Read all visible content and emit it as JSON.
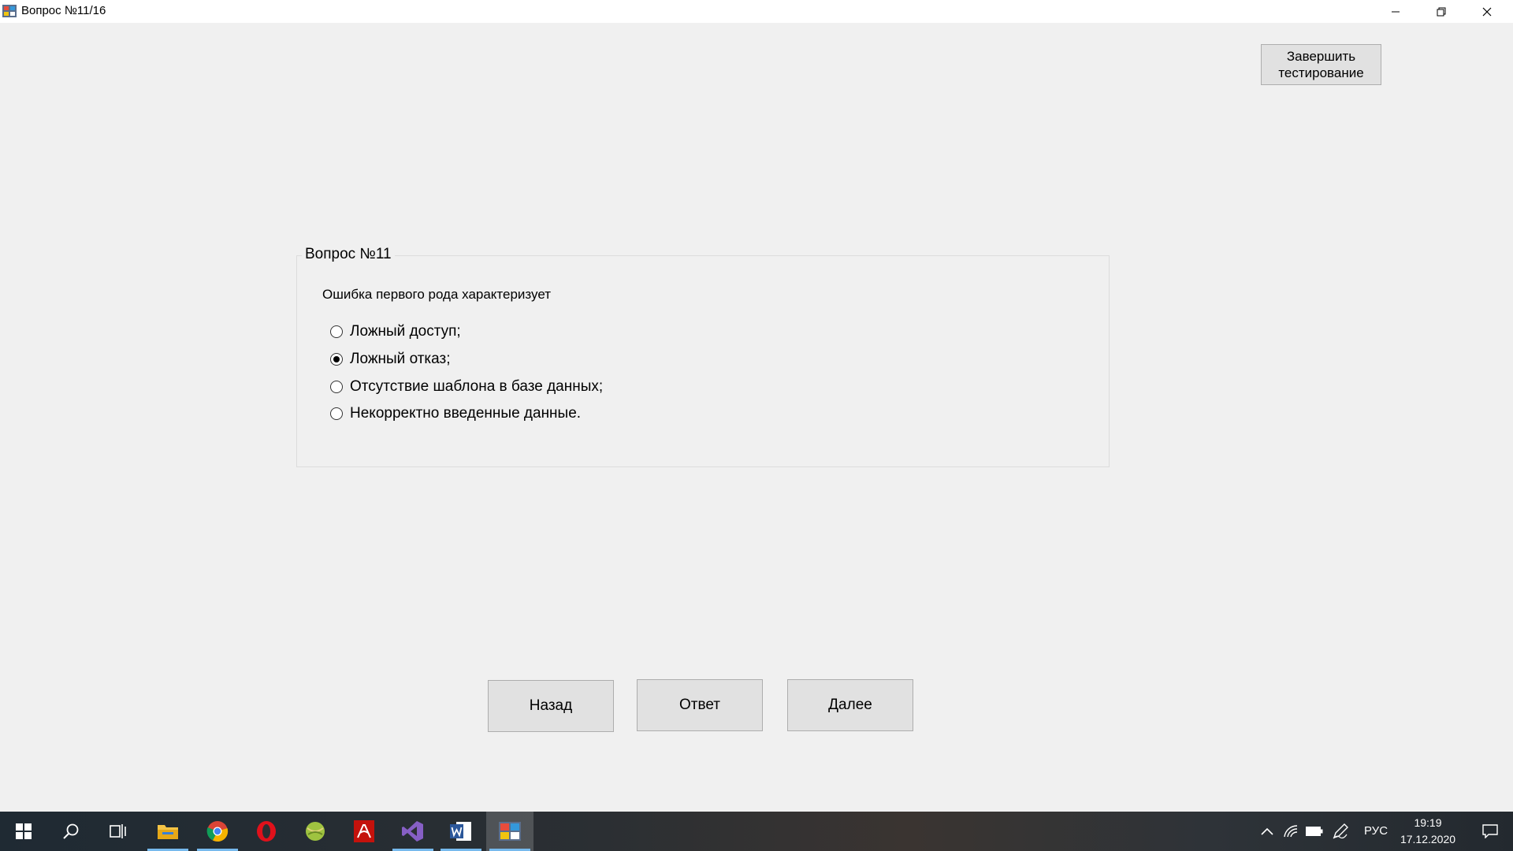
{
  "window": {
    "title": "Вопрос №11/16"
  },
  "header": {
    "finish_line1": "Завершить",
    "finish_line2": "тестирование"
  },
  "group": {
    "legend": "Вопрос №11",
    "question": "Ошибка первого рода характеризует",
    "options": [
      {
        "label": "Ложный доступ;",
        "checked": false
      },
      {
        "label": "Ложный отказ;",
        "checked": true
      },
      {
        "label": "Отсутствие шаблона в базе данных;",
        "checked": false
      },
      {
        "label": "Некорректно введенные данные.",
        "checked": false
      }
    ]
  },
  "nav": {
    "back_label": "Назад",
    "answer_label": "Ответ",
    "next_label": "Далее"
  },
  "taskbar": {
    "apps": [
      "start-icon",
      "search-icon",
      "task-view-icon",
      "file-explorer-icon",
      "chrome-icon",
      "opera-icon",
      "sports-app-icon",
      "acrobat-icon",
      "visual-studio-icon",
      "word-icon",
      "test-app-icon"
    ],
    "language": "РУС",
    "time": "19:19",
    "date": "17.12.2020"
  },
  "colors": {
    "window_bg": "#f0f0f0",
    "button_bg": "#e1e1e1",
    "button_border": "#adadad",
    "taskbar_accent": "#76b9ed"
  }
}
